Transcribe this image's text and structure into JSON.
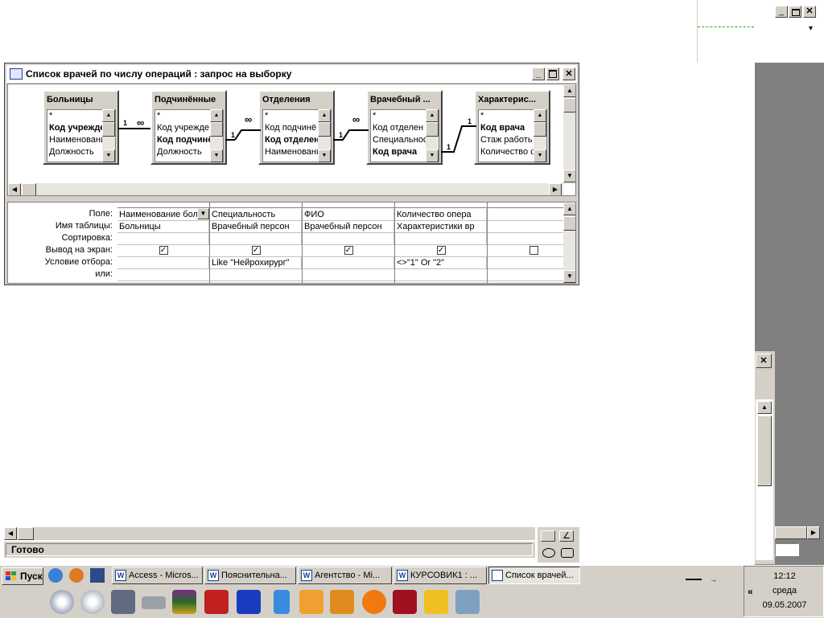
{
  "query_window": {
    "title": "Список врачей по числу операций : запрос на выборку",
    "tables": [
      {
        "name": "Больницы",
        "fields": [
          "*",
          "Код учрежде",
          "Наименовани",
          "Должность"
        ],
        "bold": [
          1
        ]
      },
      {
        "name": "Подчинённые",
        "fields": [
          "*",
          "Код учрежде",
          "Код подчинё",
          "Должность"
        ],
        "bold": [
          2
        ]
      },
      {
        "name": "Отделения",
        "fields": [
          "*",
          "Код подчинё",
          "Код отделен",
          "Наименовани"
        ],
        "bold": [
          2
        ]
      },
      {
        "name": "Врачебный ...",
        "fields": [
          "*",
          "Код отделен",
          "Специальнос",
          "Код врача"
        ],
        "bold": [
          3
        ]
      },
      {
        "name": "Характерис...",
        "fields": [
          "*",
          "Код врача",
          "Стаж работь",
          "Количество с"
        ],
        "bold": [
          1
        ]
      }
    ],
    "relations": [
      {
        "one": "1",
        "many": "∞"
      },
      {
        "one": "1",
        "many": "∞"
      },
      {
        "one": "1",
        "many": "∞"
      },
      {
        "one": "1",
        "many": "1"
      }
    ],
    "grid": {
      "row_labels": [
        "Поле:",
        "Имя таблицы:",
        "Сортировка:",
        "Вывод на экран:",
        "Условие отбора:",
        "или:"
      ],
      "columns": [
        {
          "field": "Наименование бол",
          "table": "Больницы",
          "sort": "",
          "show": true,
          "criteria": ""
        },
        {
          "field": "Специальность",
          "table": "Врачебный персон",
          "sort": "",
          "show": true,
          "criteria": "Like \"Нейрохирург\""
        },
        {
          "field": "ФИО",
          "table": "Врачебный персон",
          "sort": "",
          "show": true,
          "criteria": ""
        },
        {
          "field": "Количество опера",
          "table": "Характеристики вр",
          "sort": "",
          "show": true,
          "criteria": "<>\"1\" Or \"2\""
        },
        {
          "field": "",
          "table": "",
          "sort": "",
          "show": false,
          "criteria": ""
        }
      ]
    }
  },
  "statusbar": {
    "text": "Готово"
  },
  "taskbar": {
    "start_label": "Пуск",
    "items": [
      {
        "label": "Access - Micros..."
      },
      {
        "label": "Пояснительна..."
      },
      {
        "label": "Агентство - Mi..."
      },
      {
        "label": "КУРСОВИК1 : ..."
      },
      {
        "label": "Список врачей..."
      }
    ],
    "clock": {
      "time": "12:12",
      "day": "среда",
      "date": "09.05.2007"
    },
    "expand_label": "«"
  },
  "colors": {
    "face": "#d4d0c8",
    "title": "#ffffff",
    "desktop_gray": "#808080",
    "taskbar_blue_icon": "#1c3f94"
  }
}
